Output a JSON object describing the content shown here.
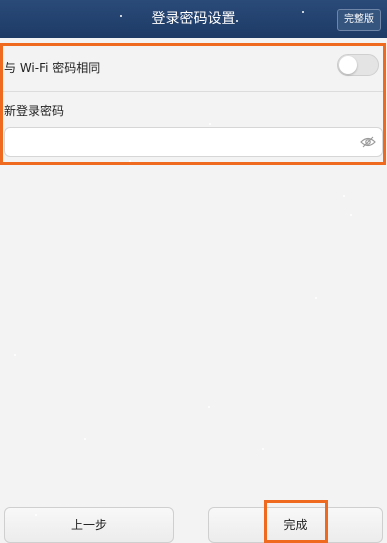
{
  "header": {
    "title": "登录密码设置",
    "full_version_label": "完整版"
  },
  "settings": {
    "same_as_wifi_label": "与 Wi-Fi 密码相同",
    "same_as_wifi_enabled": false,
    "new_password_label": "新登录密码",
    "new_password_value": ""
  },
  "footer": {
    "prev_label": "上一步",
    "done_label": "完成"
  },
  "colors": {
    "header_bg": "#1e3b66",
    "highlight": "#ef6a1e",
    "background": "#f3f3f3"
  },
  "icons": {
    "password_visibility": "eye-icon"
  }
}
